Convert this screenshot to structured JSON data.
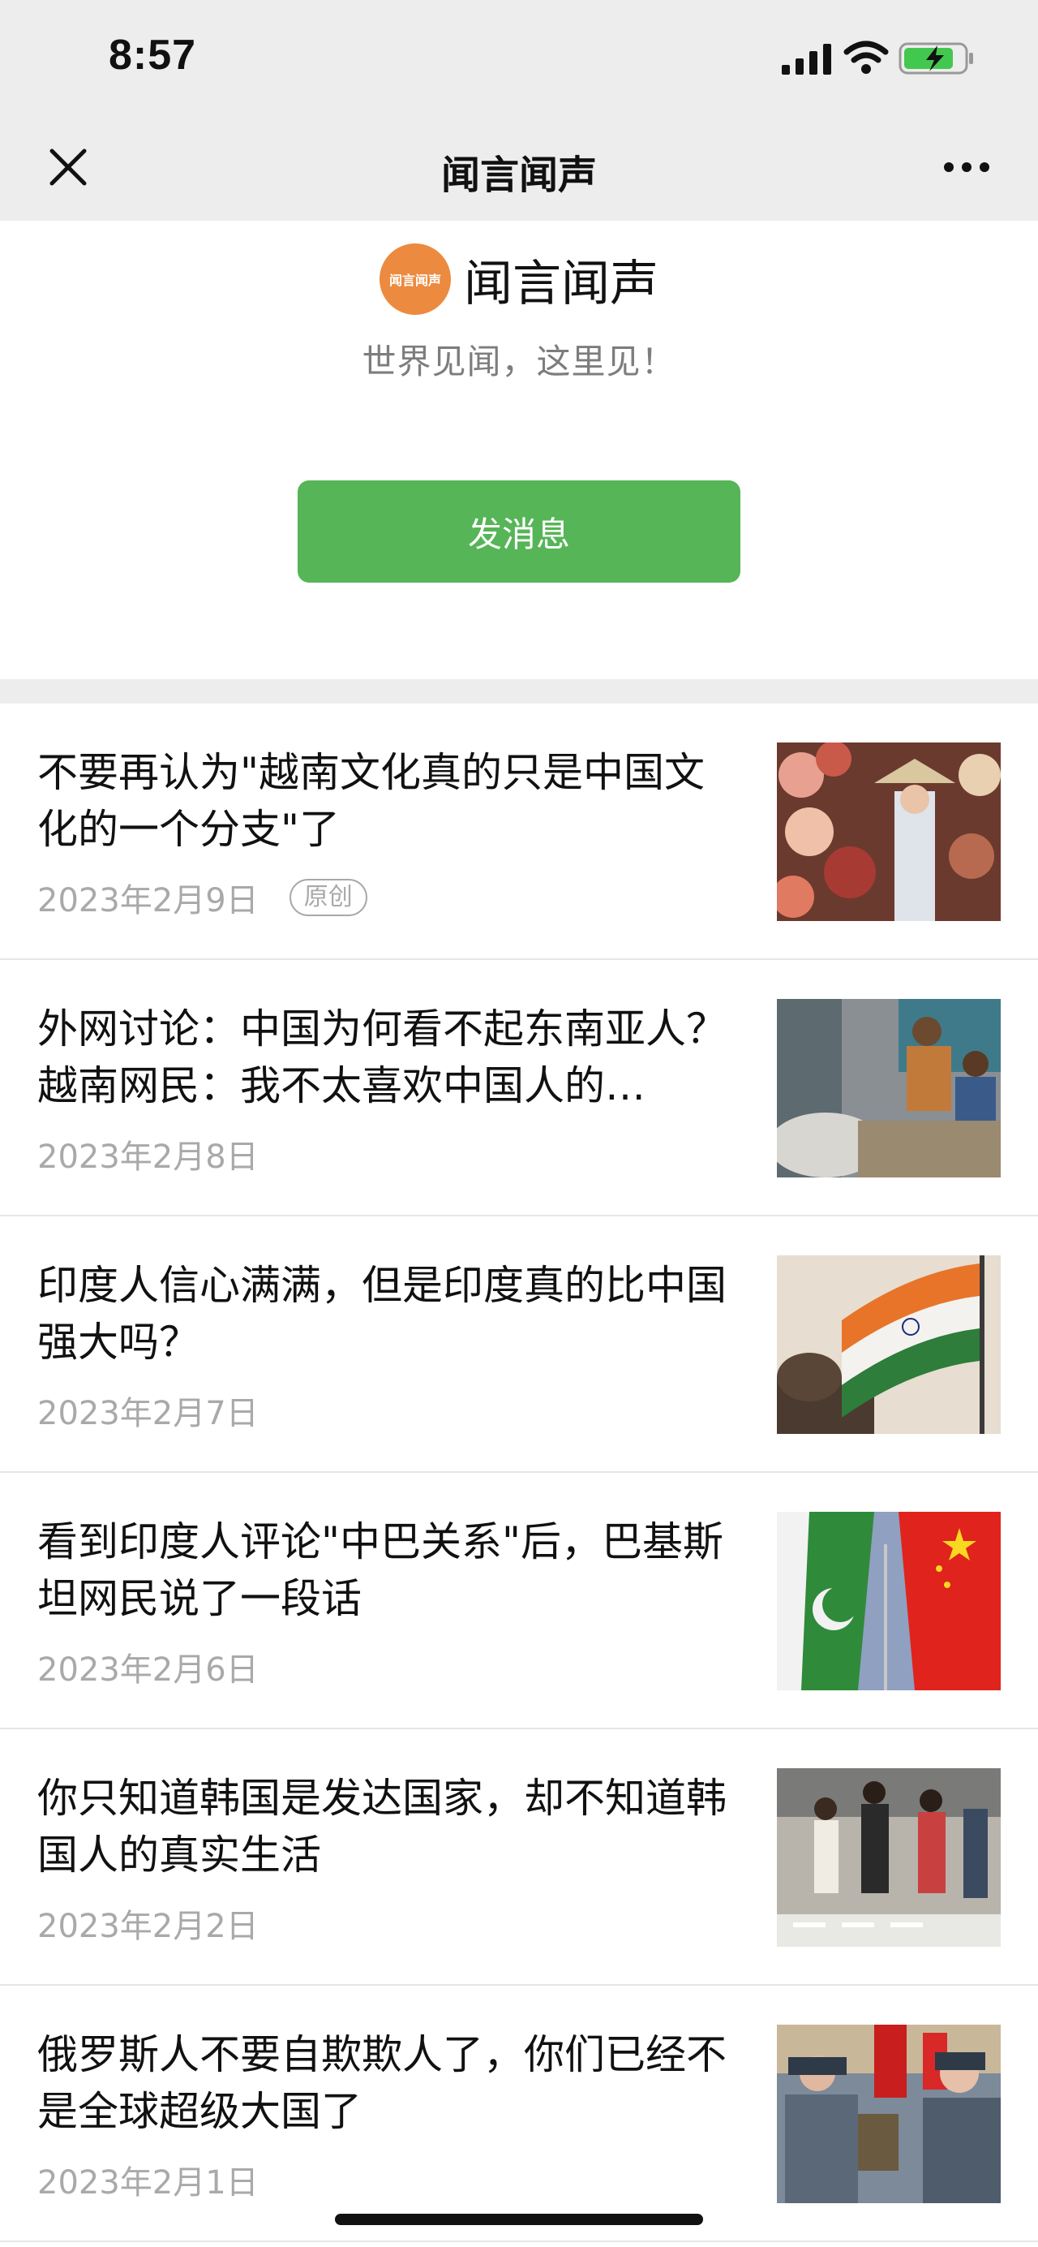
{
  "status_bar": {
    "time": "8:57"
  },
  "nav": {
    "title": "闻言闻声"
  },
  "profile": {
    "avatar_text": "闻言闻声",
    "name": "闻言闻声",
    "slogan": "世界见闻，这里见！",
    "message_button": "发消息"
  },
  "articles": [
    {
      "title": "不要再认为\"越南文化真的只是中国文化的一个分支\"了",
      "date": "2023年2月9日",
      "badge": "原创",
      "thumb": "vietnam-lantern-woman"
    },
    {
      "title": "外网讨论：中国为何看不起东南亚人？越南网民：我不太喜欢中国人的…",
      "date": "2023年2月8日",
      "badge": "",
      "thumb": "street-workers"
    },
    {
      "title": "印度人信心满满，但是印度真的比中国强大吗？",
      "date": "2023年2月7日",
      "badge": "",
      "thumb": "india-flag"
    },
    {
      "title": "看到印度人评论\"中巴关系\"后，巴基斯坦网民说了一段话",
      "date": "2023年2月6日",
      "badge": "",
      "thumb": "pakistan-china-flags"
    },
    {
      "title": "你只知道韩国是发达国家，却不知道韩国人的真实生活",
      "date": "2023年2月2日",
      "badge": "",
      "thumb": "korea-street-crowd"
    },
    {
      "title": "俄罗斯人不要自欺欺人了，你们已经不是全球超级大国了",
      "date": "2023年2月1日",
      "badge": "",
      "thumb": "russia-police-crowd"
    }
  ],
  "colors": {
    "accent_green": "#56b557",
    "avatar_orange": "#ec8a3f",
    "bar_gray": "#ededed"
  }
}
